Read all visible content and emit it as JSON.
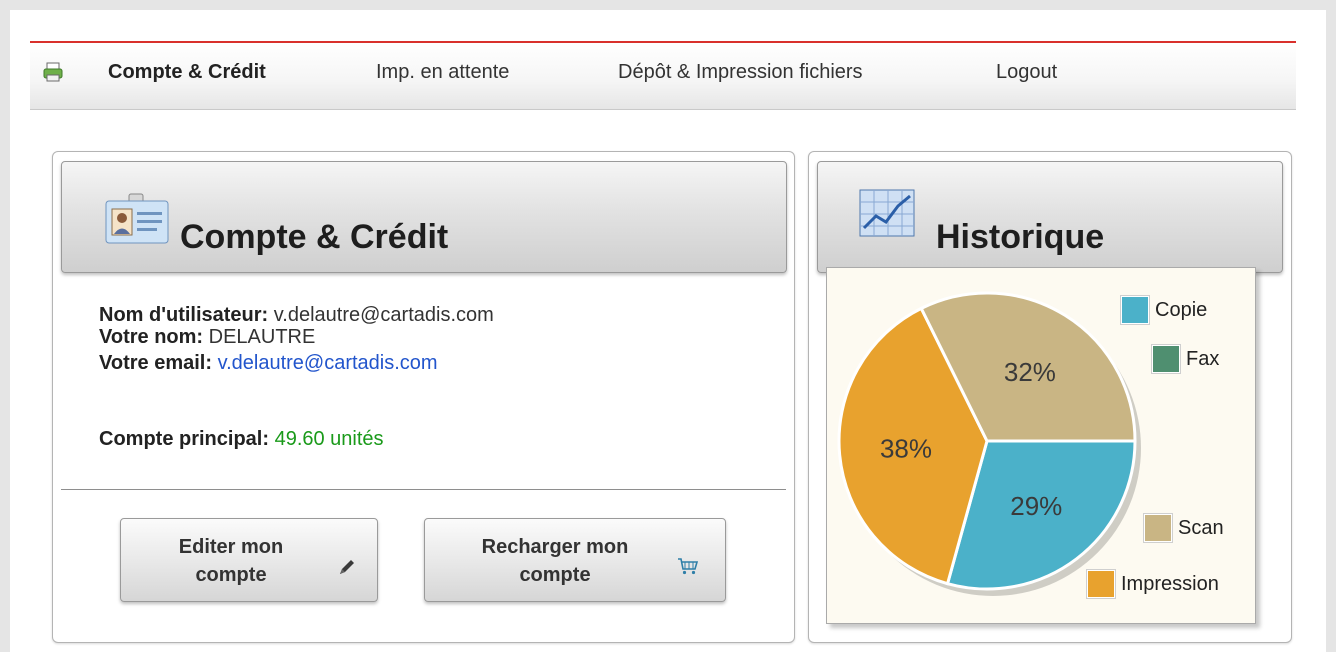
{
  "nav": {
    "logo_icon": "printer-icon",
    "items": [
      {
        "label": "Compte & Crédit",
        "active": true
      },
      {
        "label": "Imp. en attente",
        "active": false
      },
      {
        "label": "Dépôt & Impression fichiers",
        "active": false
      },
      {
        "label": "Logout",
        "active": false
      }
    ]
  },
  "account_panel": {
    "title": "Compte & Crédit",
    "icon": "id-card-icon",
    "username_label": "Nom d'utilisateur:",
    "username_value": "v.delautre@cartadis.com",
    "name_label": "Votre nom:",
    "name_value": "DELAUTRE",
    "email_label": "Votre email:",
    "email_value": "v.delautre@cartadis.com",
    "balance_label": "Compte principal:",
    "balance_value": "49.60 unités",
    "buttons": {
      "edit": {
        "line1": "Editer mon",
        "line2": "compte",
        "icon": "pencil-icon"
      },
      "recharge": {
        "line1": "Recharger mon",
        "line2": "compte",
        "icon": "cart-icon"
      }
    }
  },
  "history_panel": {
    "title": "Historique",
    "icon": "line-chart-icon"
  },
  "colors": {
    "accent_red": "#d9302c",
    "copie": "#4bb1c9",
    "fax": "#4f8f70",
    "scan": "#c9b584",
    "impression": "#e8a22e"
  },
  "chart_data": {
    "type": "pie",
    "slices": [
      {
        "name": "Copie",
        "value": 29,
        "label": "29%",
        "color": "#4bb1c9"
      },
      {
        "name": "Fax",
        "value": 0,
        "label": "",
        "color": "#4f8f70"
      },
      {
        "name": "Scan",
        "value": 32,
        "label": "32%",
        "color": "#c9b584"
      },
      {
        "name": "Impression",
        "value": 38,
        "label": "38%",
        "color": "#e8a22e"
      }
    ],
    "legend": [
      "Copie",
      "Fax",
      "Scan",
      "Impression"
    ]
  }
}
